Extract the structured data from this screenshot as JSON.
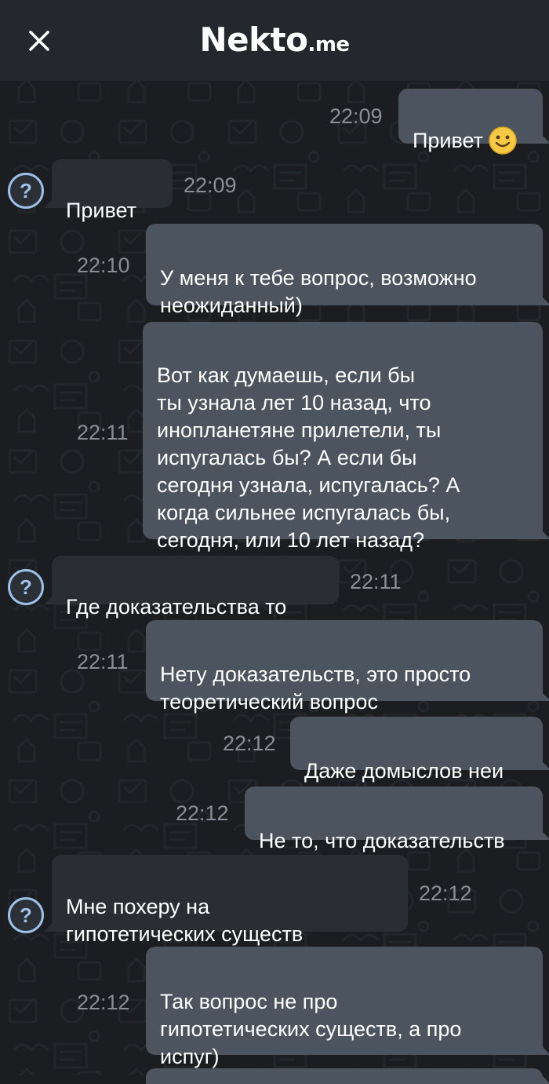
{
  "header": {
    "logo_main": "Nekto",
    "logo_domain": ".me"
  },
  "icons": {
    "close": "close-icon",
    "avatar": "question-mark-avatar-icon",
    "emoji": "smiling-face-emoji"
  },
  "colors": {
    "outgoing_bubble": "#4c5460",
    "incoming_bubble": "#2a2e33",
    "avatar_accent": "#9ec0e8",
    "timestamp": "#8a8f96"
  },
  "messages": [
    {
      "direction": "out",
      "text": "Привет",
      "time": "22:09",
      "emoji": true
    },
    {
      "direction": "in",
      "text": "Привет",
      "time": "22:09"
    },
    {
      "direction": "out",
      "text": "У меня к тебе вопрос, возможно\nнеожиданный)",
      "time": "22:10"
    },
    {
      "direction": "out",
      "text": "Вот как думаешь, если бы\nты узнала лет 10 назад, что\nинопланетяне прилетели, ты\nиспугалась бы? А если бы\nсегодня узнала, испугалась? А\nкогда сильнее испугалась бы,\nсегодня, или 10 лет назад?",
      "time": "22:11"
    },
    {
      "direction": "in",
      "text": "Где доказательства то",
      "time": "22:11"
    },
    {
      "direction": "out",
      "text": "Нету доказательств, это просто\nтеоретический вопрос",
      "time": "22:11"
    },
    {
      "direction": "out",
      "text": "Даже домыслов неи",
      "time": "22:12"
    },
    {
      "direction": "out",
      "text": "Не то, что доказательств",
      "time": "22:12"
    },
    {
      "direction": "in",
      "text": "Мне похеру на\nгипотетических существ",
      "time": "22:12"
    },
    {
      "direction": "out",
      "text": "Так вопрос не про\nгипотетических существ, а про\nиспуг)",
      "time": "22:12"
    }
  ]
}
